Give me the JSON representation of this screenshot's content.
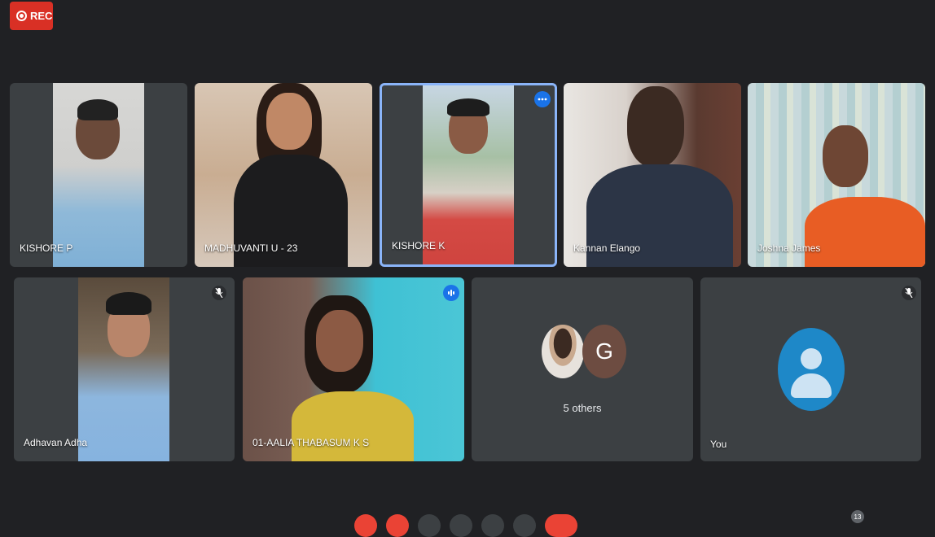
{
  "recording": {
    "label": "REC"
  },
  "participants": [
    {
      "name": "KISHORE P",
      "muted": false
    },
    {
      "name": "MADHUVANTI U - 23",
      "muted": false
    },
    {
      "name": "KISHORE K",
      "muted": false,
      "pinned_highlight": true,
      "menu_icon": "more-horiz-icon"
    },
    {
      "name": "Kannan Elango",
      "muted": false
    },
    {
      "name": "Joshna James",
      "muted": false
    },
    {
      "name": "Adhavan Adha",
      "muted": true,
      "mute_icon": "mic-off-icon"
    },
    {
      "name": "01-AALIA THABASUM K S",
      "muted": false,
      "speaking": true,
      "speaking_icon": "audio-level-icon"
    }
  ],
  "others": {
    "label": "5 others",
    "avatar_letter": "G"
  },
  "self": {
    "label": "You",
    "muted": true,
    "mute_icon": "mic-off-icon"
  },
  "controls": {
    "badge_count": "13"
  },
  "colors": {
    "background": "#202124",
    "tile": "#3c4043",
    "rec": "#d93025",
    "accent": "#1a73e8",
    "highlight": "#8ab4f8"
  }
}
